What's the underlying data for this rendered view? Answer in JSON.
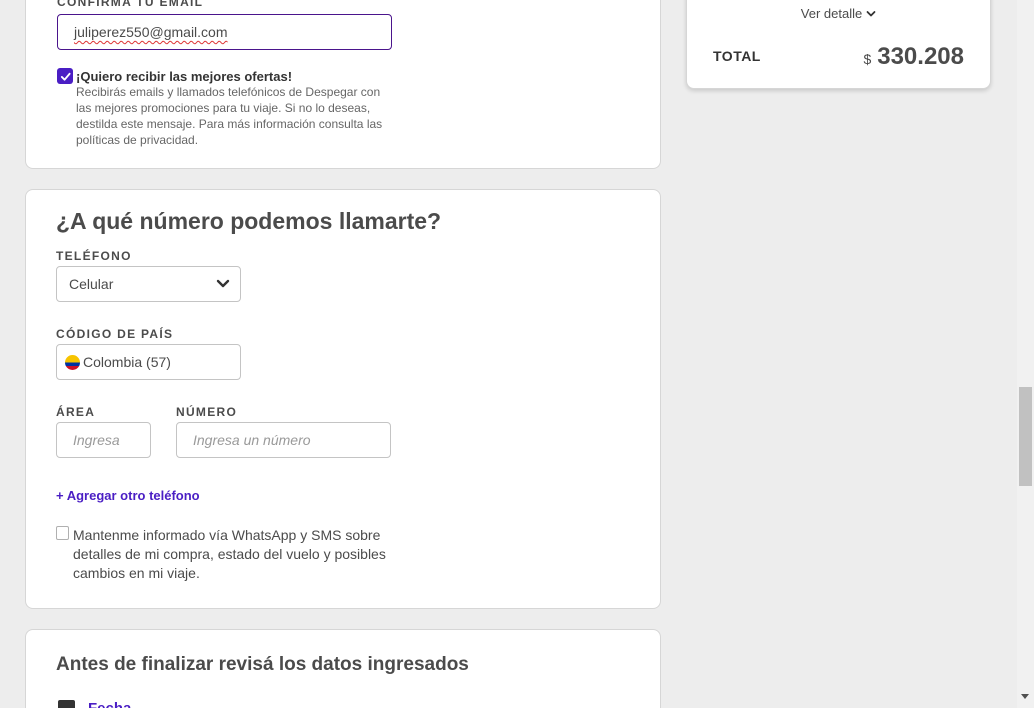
{
  "email_section": {
    "confirm_label": "CONFIRMA TU EMAIL",
    "email_value": "juliperez550@gmail.com",
    "offers_title": "¡Quiero recibir las mejores ofertas!",
    "offers_description": "Recibirás emails y llamados telefónicos de Despegar con las mejores promociones para tu viaje. Si no lo deseas, destilda este mensaje. Para más información consulta las políticas de privacidad.",
    "offers_checked": true
  },
  "phone_section": {
    "title": "¿A qué número podemos llamarte?",
    "phone_label": "TELÉFONO",
    "phone_type": "Celular",
    "country_label": "CÓDIGO DE PAÍS",
    "country_value": "Colombia (57)",
    "area_label": "ÁREA",
    "area_placeholder": "Ingresa",
    "number_label": "NÚMERO",
    "number_placeholder": "Ingresa un número",
    "add_phone_link": "+ Agregar otro teléfono",
    "whatsapp_text": "Mantenme informado vía WhatsApp y SMS sobre detalles de mi compra, estado del vuelo y posibles cambios en mi viaje.",
    "whatsapp_checked": false
  },
  "review_section": {
    "title": "Antes de finalizar revisá los datos ingresados",
    "item_label": "Fecha"
  },
  "summary": {
    "detail_link": "Ver detalle",
    "total_label": "TOTAL",
    "currency": "$",
    "amount": "330.208"
  },
  "colors": {
    "accent": "#4a1ec4",
    "background": "#ededed",
    "card": "#ffffff"
  }
}
